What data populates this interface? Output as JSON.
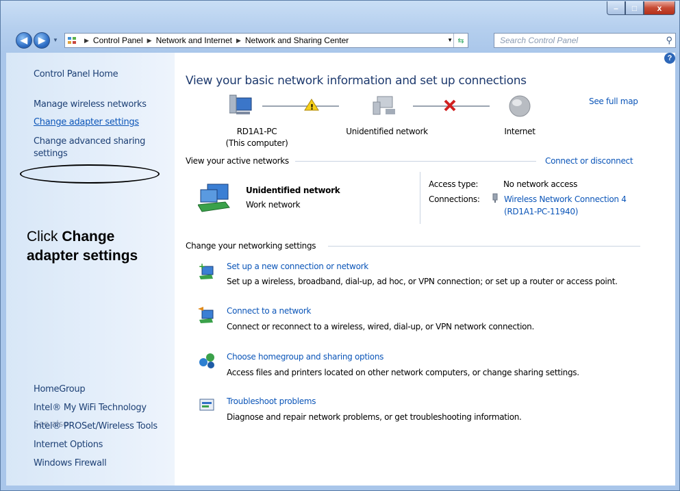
{
  "window": {
    "min_label": "–",
    "max_label": "□",
    "close_label": "x"
  },
  "navbar": {
    "back_label": "◀",
    "forward_label": "▶",
    "breadcrumbs": [
      "Control Panel",
      "Network and Internet",
      "Network and Sharing Center"
    ],
    "search_placeholder": "Search Control Panel"
  },
  "sidebar": {
    "home": "Control Panel Home",
    "tasks": [
      "Manage wireless networks",
      "Change adapter settings",
      "Change advanced sharing",
      "settings"
    ],
    "see_also_title": "See also",
    "see_also": [
      "HomeGroup",
      "Intel® My WiFi Technology",
      "Intel® PROSet/Wireless Tools",
      "Internet Options",
      "Windows Firewall"
    ]
  },
  "instruction": {
    "prefix": "Click ",
    "bold_line1": "Change",
    "bold_line2": "adapter settings"
  },
  "main": {
    "title": "View your basic network information and set up connections",
    "see_full_map": "See full map",
    "map": {
      "computer_name": "RD1A1-PC",
      "computer_sub": "(This computer)",
      "network": "Unidentified network",
      "internet": "Internet"
    },
    "active_networks": {
      "heading": "View your active networks",
      "connect_link": "Connect or disconnect",
      "network_name": "Unidentified network",
      "network_type": "Work network",
      "access_type_label": "Access type:",
      "access_type_value": "No network access",
      "connections_label": "Connections:",
      "connection_line1": "Wireless Network Connection 4",
      "connection_line2": "(RD1A1-PC-11940)"
    },
    "settings": {
      "heading": "Change your networking settings",
      "tasks": [
        {
          "title": "Set up a new connection or network",
          "desc": "Set up a wireless, broadband, dial-up, ad hoc, or VPN connection; or set up a router or access point."
        },
        {
          "title": "Connect to a network",
          "desc": "Connect or reconnect to a wireless, wired, dial-up, or VPN network connection."
        },
        {
          "title": "Choose homegroup and sharing options",
          "desc": "Access files and printers located on other network computers, or change sharing settings."
        },
        {
          "title": "Troubleshoot problems",
          "desc": "Diagnose and repair network problems, or get troubleshooting information."
        }
      ]
    }
  }
}
